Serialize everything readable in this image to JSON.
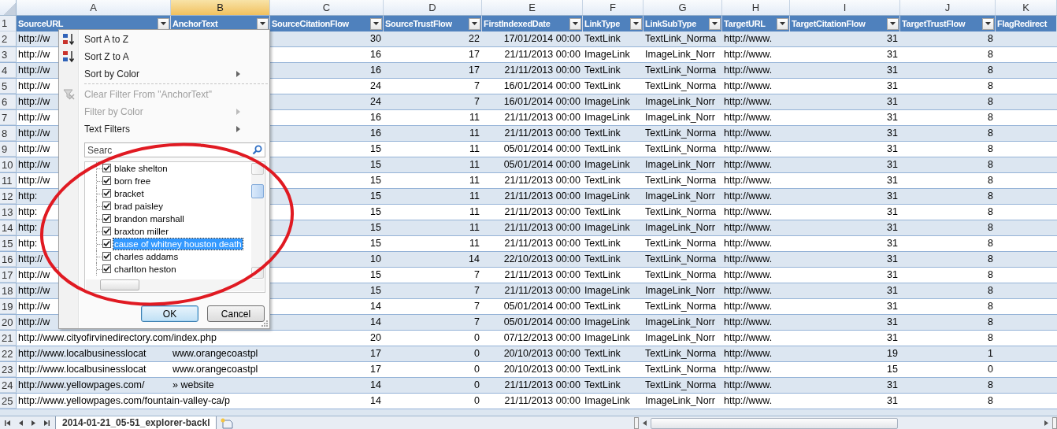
{
  "column_headers": [
    {
      "label": "A",
      "selected": false
    },
    {
      "label": "B",
      "selected": true
    },
    {
      "label": "C",
      "selected": false
    },
    {
      "label": "D",
      "selected": false
    },
    {
      "label": "E",
      "selected": false
    },
    {
      "label": "F",
      "selected": false
    },
    {
      "label": "G",
      "selected": false
    },
    {
      "label": "H",
      "selected": false
    },
    {
      "label": "I",
      "selected": false
    },
    {
      "label": "J",
      "selected": false
    },
    {
      "label": "K",
      "selected": false
    }
  ],
  "header_row": {
    "row": "1",
    "columns": [
      {
        "label": "SourceURL",
        "filter": true
      },
      {
        "label": "AnchorText",
        "filter": true
      },
      {
        "label": "SourceCitationFlow",
        "filter": true
      },
      {
        "label": "SourceTrustFlow",
        "filter": true
      },
      {
        "label": "FirstIndexedDate",
        "filter": true
      },
      {
        "label": "LinkType",
        "filter": true
      },
      {
        "label": "LinkSubType",
        "filter": true
      },
      {
        "label": "TargetURL",
        "filter": true
      },
      {
        "label": "TargetCitationFlow",
        "filter": true
      },
      {
        "label": "TargetTrustFlow",
        "filter": true
      },
      {
        "label": "FlagRedirect",
        "filter": false
      }
    ]
  },
  "rows": [
    {
      "row": "2",
      "source_url": "http://w",
      "source_citation_flow": "30",
      "source_trust_flow": "22",
      "first_indexed_date": "17/01/2014 00:00",
      "link_type": "TextLink",
      "link_sub_type": "TextLink_Norma",
      "target_url": "http://www.",
      "target_citation_flow": "31",
      "target_trust_flow": "8"
    },
    {
      "row": "3",
      "source_url": "http://w",
      "source_citation_flow": "16",
      "source_trust_flow": "17",
      "first_indexed_date": "21/11/2013 00:00",
      "link_type": "ImageLink",
      "link_sub_type": "ImageLink_Norr",
      "target_url": "http://www.",
      "target_citation_flow": "31",
      "target_trust_flow": "8"
    },
    {
      "row": "4",
      "source_url": "http://w",
      "source_citation_flow": "16",
      "source_trust_flow": "17",
      "first_indexed_date": "21/11/2013 00:00",
      "link_type": "TextLink",
      "link_sub_type": "TextLink_Norma",
      "target_url": "http://www.",
      "target_citation_flow": "31",
      "target_trust_flow": "8"
    },
    {
      "row": "5",
      "source_url": "http://w",
      "source_citation_flow": "24",
      "source_trust_flow": "7",
      "first_indexed_date": "16/01/2014 00:00",
      "link_type": "TextLink",
      "link_sub_type": "TextLink_Norma",
      "target_url": "http://www.",
      "target_citation_flow": "31",
      "target_trust_flow": "8"
    },
    {
      "row": "6",
      "source_url": "http://w",
      "source_citation_flow": "24",
      "source_trust_flow": "7",
      "first_indexed_date": "16/01/2014 00:00",
      "link_type": "ImageLink",
      "link_sub_type": "ImageLink_Norr",
      "target_url": "http://www.",
      "target_citation_flow": "31",
      "target_trust_flow": "8"
    },
    {
      "row": "7",
      "source_url": "http://w",
      "source_citation_flow": "16",
      "source_trust_flow": "11",
      "first_indexed_date": "21/11/2013 00:00",
      "link_type": "ImageLink",
      "link_sub_type": "ImageLink_Norr",
      "target_url": "http://www.",
      "target_citation_flow": "31",
      "target_trust_flow": "8"
    },
    {
      "row": "8",
      "source_url": "http://w",
      "source_citation_flow": "16",
      "source_trust_flow": "11",
      "first_indexed_date": "21/11/2013 00:00",
      "link_type": "TextLink",
      "link_sub_type": "TextLink_Norma",
      "target_url": "http://www.",
      "target_citation_flow": "31",
      "target_trust_flow": "8"
    },
    {
      "row": "9",
      "source_url": "http://w",
      "source_citation_flow": "15",
      "source_trust_flow": "11",
      "first_indexed_date": "05/01/2014 00:00",
      "link_type": "TextLink",
      "link_sub_type": "TextLink_Norma",
      "target_url": "http://www.",
      "target_citation_flow": "31",
      "target_trust_flow": "8"
    },
    {
      "row": "10",
      "source_url": "http://w",
      "source_citation_flow": "15",
      "source_trust_flow": "11",
      "first_indexed_date": "05/01/2014 00:00",
      "link_type": "ImageLink",
      "link_sub_type": "ImageLink_Norr",
      "target_url": "http://www.",
      "target_citation_flow": "31",
      "target_trust_flow": "8"
    },
    {
      "row": "11",
      "source_url": "http://w",
      "source_citation_flow": "15",
      "source_trust_flow": "11",
      "first_indexed_date": "21/11/2013 00:00",
      "link_type": "TextLink",
      "link_sub_type": "TextLink_Norma",
      "target_url": "http://www.",
      "target_citation_flow": "31",
      "target_trust_flow": "8"
    },
    {
      "row": "12",
      "source_url": "http:",
      "source_citation_flow": "15",
      "source_trust_flow": "11",
      "first_indexed_date": "21/11/2013 00:00",
      "link_type": "ImageLink",
      "link_sub_type": "ImageLink_Norr",
      "target_url": "http://www.",
      "target_citation_flow": "31",
      "target_trust_flow": "8"
    },
    {
      "row": "13",
      "source_url": "http:",
      "source_citation_flow": "15",
      "source_trust_flow": "11",
      "first_indexed_date": "21/11/2013 00:00",
      "link_type": "TextLink",
      "link_sub_type": "TextLink_Norma",
      "target_url": "http://www.",
      "target_citation_flow": "31",
      "target_trust_flow": "8"
    },
    {
      "row": "14",
      "source_url": "http:",
      "source_citation_flow": "15",
      "source_trust_flow": "11",
      "first_indexed_date": "21/11/2013 00:00",
      "link_type": "ImageLink",
      "link_sub_type": "ImageLink_Norr",
      "target_url": "http://www.",
      "target_citation_flow": "31",
      "target_trust_flow": "8"
    },
    {
      "row": "15",
      "source_url": "http:",
      "source_citation_flow": "15",
      "source_trust_flow": "11",
      "first_indexed_date": "21/11/2013 00:00",
      "link_type": "TextLink",
      "link_sub_type": "TextLink_Norma",
      "target_url": "http://www.",
      "target_citation_flow": "31",
      "target_trust_flow": "8"
    },
    {
      "row": "16",
      "source_url": "http://",
      "source_citation_flow": "10",
      "source_trust_flow": "14",
      "first_indexed_date": "22/10/2013 00:00",
      "link_type": "TextLink",
      "link_sub_type": "TextLink_Norma",
      "target_url": "http://www.",
      "target_citation_flow": "31",
      "target_trust_flow": "8"
    },
    {
      "row": "17",
      "source_url": "http://w",
      "source_citation_flow": "15",
      "source_trust_flow": "7",
      "first_indexed_date": "21/11/2013 00:00",
      "link_type": "TextLink",
      "link_sub_type": "TextLink_Norma",
      "target_url": "http://www.",
      "target_citation_flow": "31",
      "target_trust_flow": "8"
    },
    {
      "row": "18",
      "source_url": "http://w",
      "source_citation_flow": "15",
      "source_trust_flow": "7",
      "first_indexed_date": "21/11/2013 00:00",
      "link_type": "ImageLink",
      "link_sub_type": "ImageLink_Norr",
      "target_url": "http://www.",
      "target_citation_flow": "31",
      "target_trust_flow": "8"
    },
    {
      "row": "19",
      "source_url": "http://w",
      "source_citation_flow": "14",
      "source_trust_flow": "7",
      "first_indexed_date": "05/01/2014 00:00",
      "link_type": "TextLink",
      "link_sub_type": "TextLink_Norma",
      "target_url": "http://www.",
      "target_citation_flow": "31",
      "target_trust_flow": "8"
    },
    {
      "row": "20",
      "source_url": "http://w",
      "source_citation_flow": "14",
      "source_trust_flow": "7",
      "first_indexed_date": "05/01/2014 00:00",
      "link_type": "ImageLink",
      "link_sub_type": "ImageLink_Norr",
      "target_url": "http://www.",
      "target_citation_flow": "31",
      "target_trust_flow": "8"
    },
    {
      "row": "21",
      "source_url": "http://www.cityofirvinedirectory.com/index.php",
      "overflow": true,
      "source_citation_flow": "20",
      "source_trust_flow": "0",
      "first_indexed_date": "07/12/2013 00:00",
      "link_type": "ImageLink",
      "link_sub_type": "ImageLink_Norr",
      "target_url": "http://www.",
      "target_citation_flow": "31",
      "target_trust_flow": "8"
    },
    {
      "row": "22",
      "source_url": "http://www.localbusinesslocat",
      "anchor_text": "www.orangecoastpl",
      "source_citation_flow": "17",
      "source_trust_flow": "0",
      "first_indexed_date": "20/10/2013 00:00",
      "link_type": "TextLink",
      "link_sub_type": "TextLink_Norma",
      "target_url": "http://www.",
      "target_citation_flow": "19",
      "target_trust_flow": "1"
    },
    {
      "row": "23",
      "source_url": "http://www.localbusinesslocat",
      "anchor_text": "www.orangecoastpl",
      "source_citation_flow": "17",
      "source_trust_flow": "0",
      "first_indexed_date": "20/10/2013 00:00",
      "link_type": "TextLink",
      "link_sub_type": "TextLink_Norma",
      "target_url": "http://www.",
      "target_citation_flow": "15",
      "target_trust_flow": "0"
    },
    {
      "row": "24",
      "source_url": "http://www.yellowpages.com/",
      "anchor_text": "» website",
      "source_citation_flow": "14",
      "source_trust_flow": "0",
      "first_indexed_date": "21/11/2013 00:00",
      "link_type": "TextLink",
      "link_sub_type": "TextLink_Norma",
      "target_url": "http://www.",
      "target_citation_flow": "31",
      "target_trust_flow": "8"
    },
    {
      "row": "25",
      "source_url": "http://www.yellowpages.com/fountain-valley-ca/p",
      "overflow": true,
      "source_citation_flow": "14",
      "source_trust_flow": "0",
      "first_indexed_date": "21/11/2013 00:00",
      "link_type": "ImageLink",
      "link_sub_type": "ImageLink_Norr",
      "target_url": "http://www.",
      "target_citation_flow": "31",
      "target_trust_flow": "8"
    }
  ],
  "filter_menu": {
    "items": [
      {
        "label": "Sort A to Z",
        "kind": "sort-ascending",
        "disabled": false,
        "submenu": false
      },
      {
        "label": "Sort Z to A",
        "kind": "sort-descending",
        "disabled": false,
        "submenu": false
      },
      {
        "label": "Sort by Color",
        "kind": "plain",
        "disabled": false,
        "submenu": true
      },
      {
        "kind": "separator"
      },
      {
        "label": "Clear Filter From \"AnchorText\"",
        "kind": "clear-filter",
        "disabled": true,
        "submenu": false
      },
      {
        "label": "Filter by Color",
        "kind": "plain",
        "disabled": true,
        "submenu": true
      },
      {
        "label": "Text Filters",
        "kind": "plain",
        "disabled": false,
        "submenu": true
      }
    ],
    "search": {
      "placeholder": "Searc"
    },
    "values": [
      {
        "label": "blake shelton",
        "checked": true,
        "selected": false
      },
      {
        "label": "born free",
        "checked": true,
        "selected": false
      },
      {
        "label": "bracket",
        "checked": true,
        "selected": false
      },
      {
        "label": "brad paisley",
        "checked": true,
        "selected": false
      },
      {
        "label": "brandon marshall",
        "checked": true,
        "selected": false
      },
      {
        "label": "braxton miller",
        "checked": true,
        "selected": false
      },
      {
        "label": "cause of whitney houston death",
        "checked": true,
        "selected": true
      },
      {
        "label": "charles addams",
        "checked": true,
        "selected": false
      },
      {
        "label": "charlton heston",
        "checked": true,
        "selected": false
      }
    ],
    "buttons": [
      {
        "label": "OK",
        "default": true
      },
      {
        "label": "Cancel",
        "default": false
      }
    ]
  },
  "annotations": [
    {
      "kind": "ellipse"
    }
  ],
  "sheet_tabs": [
    {
      "label": "2014-01-21_05-51_explorer-backl",
      "selected": true
    }
  ]
}
